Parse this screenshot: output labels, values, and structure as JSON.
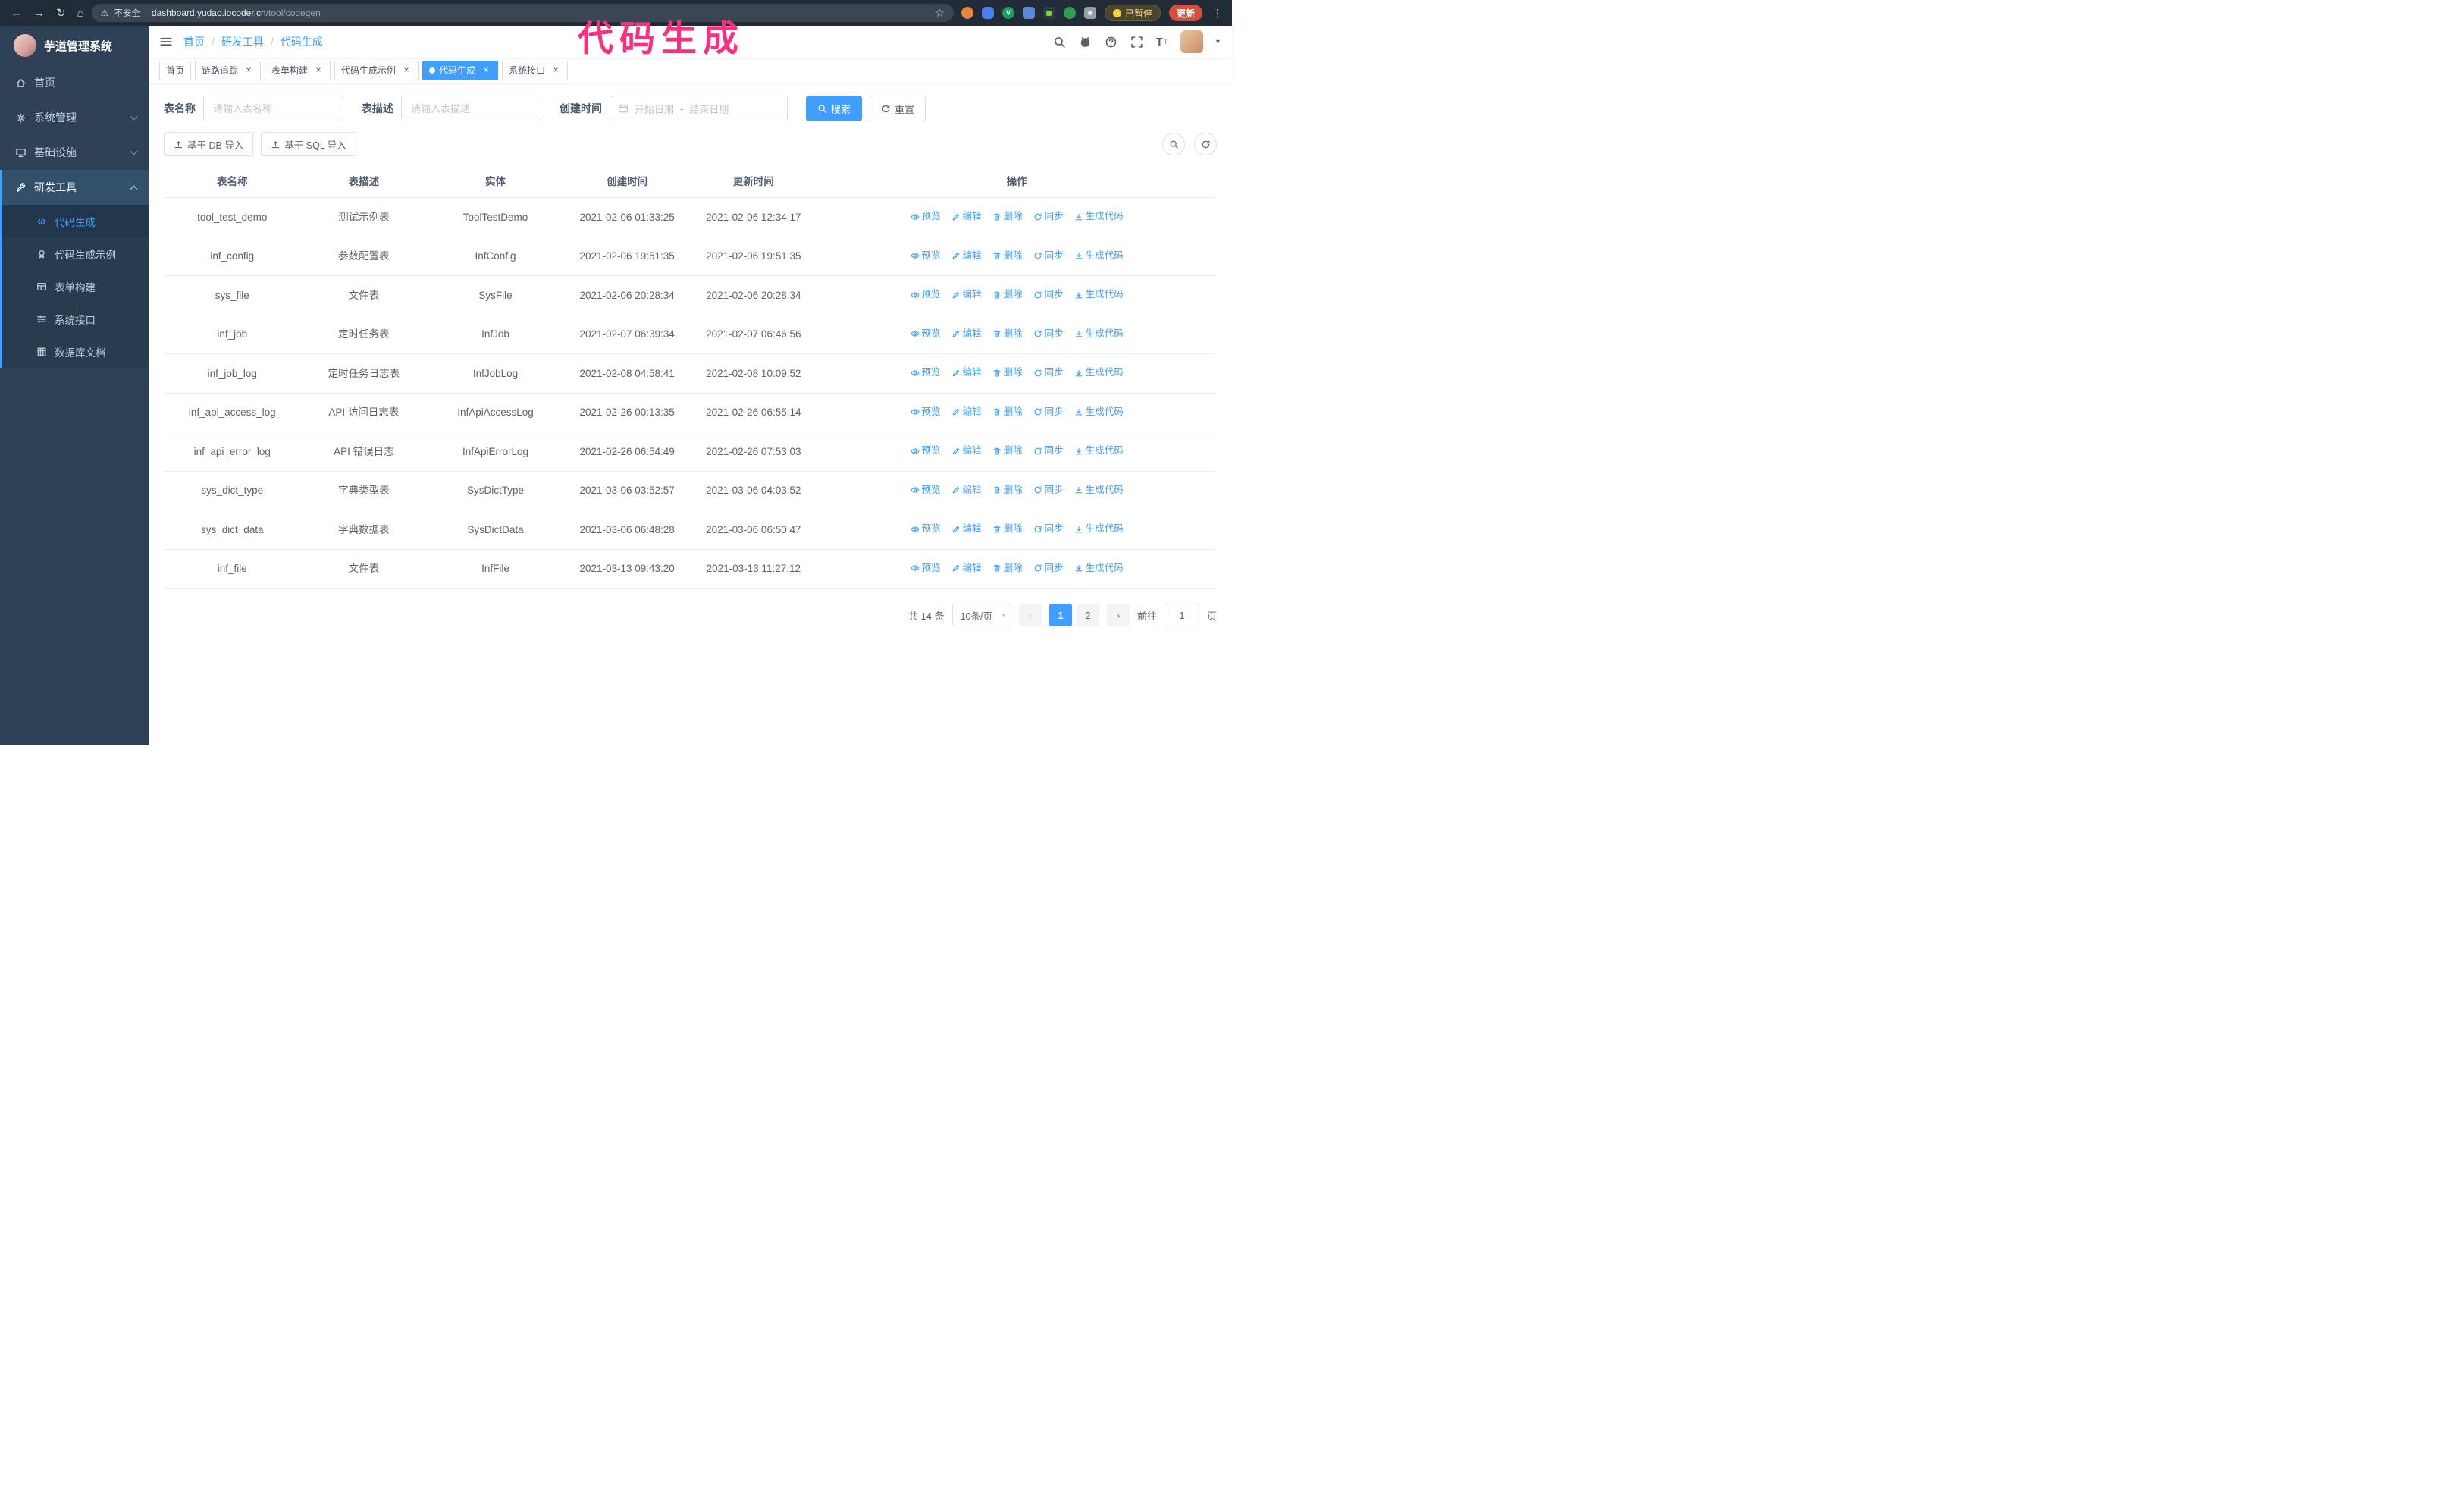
{
  "annotation": {
    "text": "代码生成",
    "color": "#fb2f80"
  },
  "colors": {
    "primary": "#409eff"
  },
  "browser": {
    "security_warning": "不安全",
    "url_host": "dashboard.yudao.iocoder.cn",
    "url_path": "/tool/codegen",
    "paused_badge": "已暂停",
    "update_button": "更新"
  },
  "sidebar": {
    "logo_title": "芋道管理系统",
    "items": [
      {
        "label": "首页",
        "icon": "home",
        "group": false
      },
      {
        "label": "系统管理",
        "icon": "gear",
        "group": true
      },
      {
        "label": "基础设施",
        "icon": "infra",
        "group": true
      },
      {
        "label": "研发工具",
        "icon": "tools",
        "group": true,
        "expanded": true,
        "children": [
          {
            "label": "代码生成",
            "icon": "code",
            "active": true
          },
          {
            "label": "代码生成示例",
            "icon": "example"
          },
          {
            "label": "表单构建",
            "icon": "form"
          },
          {
            "label": "系统接口",
            "icon": "api"
          },
          {
            "label": "数据库文档",
            "icon": "db"
          }
        ]
      }
    ]
  },
  "header": {
    "breadcrumb": [
      "首页",
      "研发工具",
      "代码生成"
    ],
    "separator": "/"
  },
  "tabs": [
    {
      "label": "首页",
      "closable": false,
      "active": false
    },
    {
      "label": "链路追踪",
      "closable": true,
      "active": false
    },
    {
      "label": "表单构建",
      "closable": true,
      "active": false
    },
    {
      "label": "代码生成示例",
      "closable": true,
      "active": false
    },
    {
      "label": "代码生成",
      "closable": true,
      "active": true
    },
    {
      "label": "系统接口",
      "closable": true,
      "active": false
    }
  ],
  "filters": {
    "table_name_label": "表名称",
    "table_name_placeholder": "请输入表名称",
    "table_desc_label": "表描述",
    "table_desc_placeholder": "请输入表描述",
    "create_time_label": "创建时间",
    "start_placeholder": "开始日期",
    "range_separator": "-",
    "end_placeholder": "结束日期",
    "search_button": "搜索",
    "reset_button": "重置"
  },
  "toolbar": {
    "import_db_button": "基于 DB 导入",
    "import_sql_button": "基于 SQL 导入"
  },
  "table": {
    "columns": [
      "表名称",
      "表描述",
      "实体",
      "创建时间",
      "更新时间",
      "操作"
    ],
    "actions": [
      "预览",
      "编辑",
      "删除",
      "同步",
      "生成代码"
    ],
    "rows": [
      {
        "name": "tool_test_demo",
        "desc": "测试示例表",
        "entity": "ToolTestDemo",
        "created": "2021-02-06 01:33:25",
        "updated": "2021-02-06 12:34:17"
      },
      {
        "name": "inf_config",
        "desc": "参数配置表",
        "entity": "InfConfig",
        "created": "2021-02-06 19:51:35",
        "updated": "2021-02-06 19:51:35"
      },
      {
        "name": "sys_file",
        "desc": "文件表",
        "entity": "SysFile",
        "created": "2021-02-06 20:28:34",
        "updated": "2021-02-06 20:28:34"
      },
      {
        "name": "inf_job",
        "desc": "定时任务表",
        "entity": "InfJob",
        "created": "2021-02-07 06:39:34",
        "updated": "2021-02-07 06:46:56"
      },
      {
        "name": "inf_job_log",
        "desc": "定时任务日志表",
        "entity": "InfJobLog",
        "created": "2021-02-08 04:58:41",
        "updated": "2021-02-08 10:09:52"
      },
      {
        "name": "inf_api_access_log",
        "desc": "API 访问日志表",
        "entity": "InfApiAccessLog",
        "created": "2021-02-26 00:13:35",
        "updated": "2021-02-26 06:55:14"
      },
      {
        "name": "inf_api_error_log",
        "desc": "API 错误日志",
        "entity": "InfApiErrorLog",
        "created": "2021-02-26 06:54:49",
        "updated": "2021-02-26 07:53:03"
      },
      {
        "name": "sys_dict_type",
        "desc": "字典类型表",
        "entity": "SysDictType",
        "created": "2021-03-06 03:52:57",
        "updated": "2021-03-06 04:03:52"
      },
      {
        "name": "sys_dict_data",
        "desc": "字典数据表",
        "entity": "SysDictData",
        "created": "2021-03-06 06:48:28",
        "updated": "2021-03-06 06:50:47"
      },
      {
        "name": "inf_file",
        "desc": "文件表",
        "entity": "InfFile",
        "created": "2021-03-13 09:43:20",
        "updated": "2021-03-13 11:27:12"
      }
    ]
  },
  "pagination": {
    "total_label": "共 14 条",
    "page_size_label": "10条/页",
    "pages": [
      "1",
      "2"
    ],
    "active_page": "1",
    "goto_label": "前往",
    "goto_value": "1",
    "goto_suffix": "页"
  }
}
